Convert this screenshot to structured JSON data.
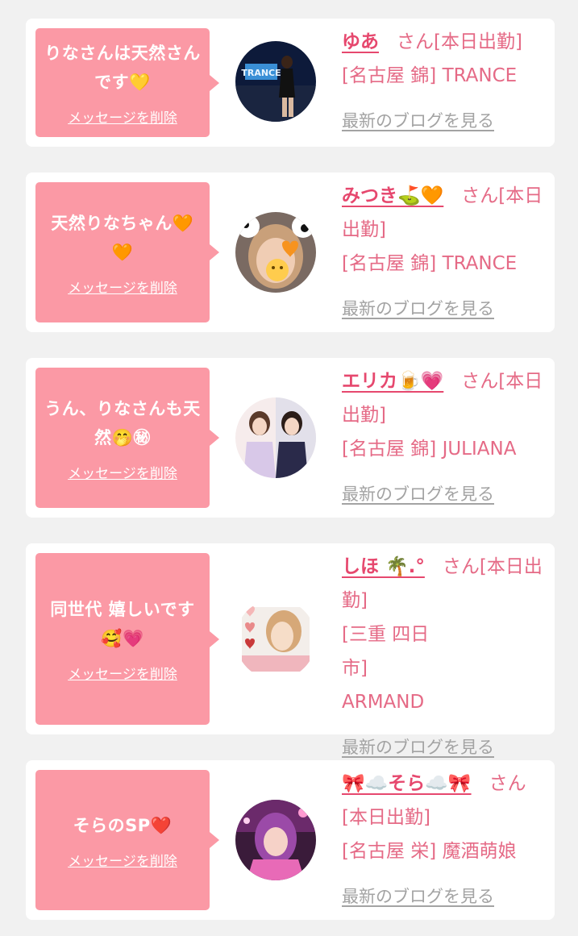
{
  "messages": [
    {
      "bubble_text": "りなさんは天然さんです💛",
      "delete_label": "メッセージを削除",
      "sender_name": "ゆあ",
      "honorific": "さん",
      "status": "[本日出勤]",
      "location": "[名古屋 錦] TRANCE",
      "blog_label": "最新のブログを見る"
    },
    {
      "bubble_text": "天然りなちゃん🧡🧡",
      "delete_label": "メッセージを削除",
      "sender_name": "みつき⛳🧡",
      "honorific": "さん",
      "status": "[本日出勤]",
      "location": "[名古屋 錦] TRANCE",
      "blog_label": "最新のブログを見る"
    },
    {
      "bubble_text": "うん、りなさんも天然🤭㊙",
      "delete_label": "メッセージを削除",
      "sender_name": "エリカ🍺💗",
      "honorific": "さん",
      "status": "[本日出勤]",
      "location": "[名古屋 錦] JULIANA",
      "blog_label": "最新のブログを見る"
    },
    {
      "bubble_text": "同世代 嬉しいです🥰💗",
      "delete_label": "メッセージを削除",
      "sender_name": "しほ 🌴.°",
      "honorific": "さん",
      "status": "[本日出勤]",
      "location": "[三重 四日市] ARMAND",
      "blog_label": "最新のブログを見る"
    },
    {
      "bubble_text": "そらのSP❤️",
      "delete_label": "メッセージを削除",
      "sender_name": "🎀☁️そら☁️🎀",
      "honorific": "さん",
      "status": "[本日出勤]",
      "location": "[名古屋 栄] 魔酒萌娘",
      "blog_label": "最新のブログを見る"
    }
  ]
}
